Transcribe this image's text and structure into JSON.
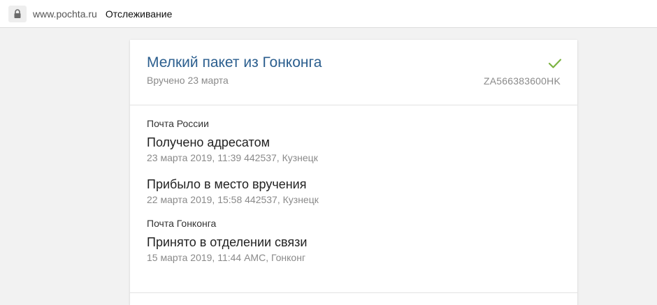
{
  "browser": {
    "url": "www.pochta.ru",
    "page_title": "Отслеживание",
    "icons": {
      "lock": "lock-icon"
    }
  },
  "package": {
    "title": "Мелкий пакет из Гонконга",
    "status": "Вручено 23 марта",
    "tracking_number": "ZA566383600HK",
    "status_icon": "check-icon",
    "accent_color": "#2b5e8e",
    "check_color": "#7cb342"
  },
  "groups": [
    {
      "carrier": "Почта России",
      "events": [
        {
          "title": "Получено адресатом",
          "meta": "23 марта 2019, 11:39 442537, Кузнецк"
        },
        {
          "title": "Прибыло в место вручения",
          "meta": "22 марта 2019, 15:58 442537, Кузнецк"
        }
      ]
    },
    {
      "carrier": "Почта Гонконга",
      "events": [
        {
          "title": "Принято в отделении связи",
          "meta": "15 марта 2019, 11:44 AMC, Гонконг"
        }
      ]
    }
  ]
}
